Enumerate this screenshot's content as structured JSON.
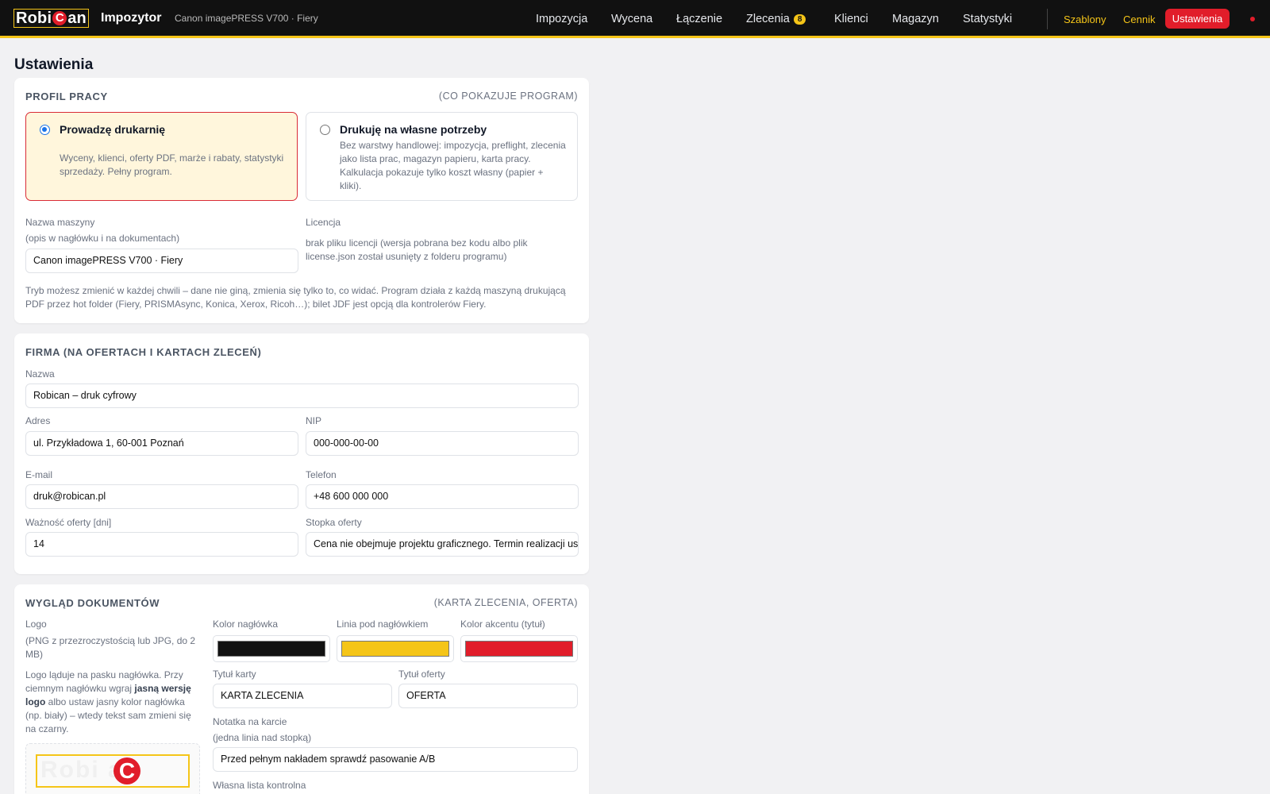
{
  "topbar": {
    "brand": {
      "part1": "Robi",
      "c": "C",
      "part2": "an"
    },
    "app_name": "Impozytor",
    "machine": "Canon imagePRESS V700 · Fiery",
    "nav": [
      {
        "label": "Impozycja"
      },
      {
        "label": "Wycena"
      },
      {
        "label": "Łączenie"
      },
      {
        "label": "Zlecenia",
        "badge": "8"
      },
      {
        "label": "Klienci"
      },
      {
        "label": "Magazyn"
      },
      {
        "label": "Statystyki"
      }
    ],
    "templates_link": "Szablony",
    "pricing_link": "Cennik",
    "settings_button": "Ustawienia",
    "accent": "#f5c518",
    "alert_color": "#e11d2a"
  },
  "page": {
    "title": "Ustawienia"
  },
  "profile": {
    "title": "PROFIL PRACY",
    "aside": "(CO POKAZUJE PROGRAM)",
    "options": [
      {
        "title": "Prowadzę drukarnię",
        "desc": "Wyceny, klienci, oferty PDF, marże i rabaty, statystyki sprzedaży. Pełny program.",
        "selected": true
      },
      {
        "title": "Drukuję na własne potrzeby",
        "desc": "Bez warstwy handlowej: impozycja, preflight, zlecenia jako lista prac, magazyn papieru, karta pracy. Kalkulacja pokazuje tylko koszt własny (papier + kliki).",
        "selected": false
      }
    ],
    "machine_label": "Nazwa maszyny",
    "machine_hint": "(opis w nagłówku i na dokumentach)",
    "machine_value": "Canon imagePRESS V700 · Fiery",
    "license_label": "Licencja",
    "license_text": "brak pliku licencji (wersja pobrana bez kodu albo plik license.json został usunięty z folderu programu)",
    "footnote": "Tryb możesz zmienić w każdej chwili – dane nie giną, zmienia się tylko to, co widać. Program działa z każdą maszyną drukującą PDF przez hot folder (Fiery, PRISMAsync, Konica, Xerox, Ricoh…); bilet JDF jest opcją dla kontrolerów Fiery."
  },
  "company": {
    "title": "FIRMA (NA OFERTACH I KARTACH ZLECEŃ)",
    "name_label": "Nazwa",
    "name_value": "Robican – druk cyfrowy",
    "address_label": "Adres",
    "address_value": "ul. Przykładowa 1, 60-001 Poznań",
    "nip_label": "NIP",
    "nip_value": "000-000-00-00",
    "email_label": "E-mail",
    "email_value": "druk@robican.pl",
    "phone_label": "Telefon",
    "phone_value": "+48 600 000 000",
    "validity_label": "Ważność oferty [dni]",
    "validity_value": "14",
    "footer_label": "Stopka oferty",
    "footer_value": "Cena nie obejmuje projektu graficznego. Termin realizacji ustalany indywidualnie."
  },
  "docs": {
    "title": "WYGLĄD DOKUMENTÓW",
    "aside": "(KARTA ZLECENIA, OFERTA)",
    "logo_label": "Logo",
    "logo_hint": "(PNG z przezroczystością lub JPG, do 2 MB)",
    "logo_note_1": "Logo ląduje na pasku nagłówka. Przy ciemnym nagłówku wgraj ",
    "logo_note_bold": "jasną wersję logo",
    "logo_note_2": " albo ustaw jasny kolor nagłówka (np. biały) – wtedy tekst sam zmieni się na czarny.",
    "header_color_label": "Kolor nagłówka",
    "header_color": "#111111",
    "line_color_label": "Linia pod nagłówkiem",
    "line_color": "#f5c518",
    "accent_color_label": "Kolor akcentu (tytuł)",
    "accent_color": "#e11d2a",
    "card_title_label": "Tytuł karty",
    "card_title_value": "KARTA ZLECENIA",
    "offer_title_label": "Tytuł oferty",
    "offer_title_value": "OFERTA",
    "note_label": "Notatka na karcie",
    "note_hint": "(jedna linia nad stopką)",
    "note_value": "Przed pełnym nakładem sprawdź pasowanie A/B",
    "checklist_label": "Własna lista kontrolna"
  }
}
